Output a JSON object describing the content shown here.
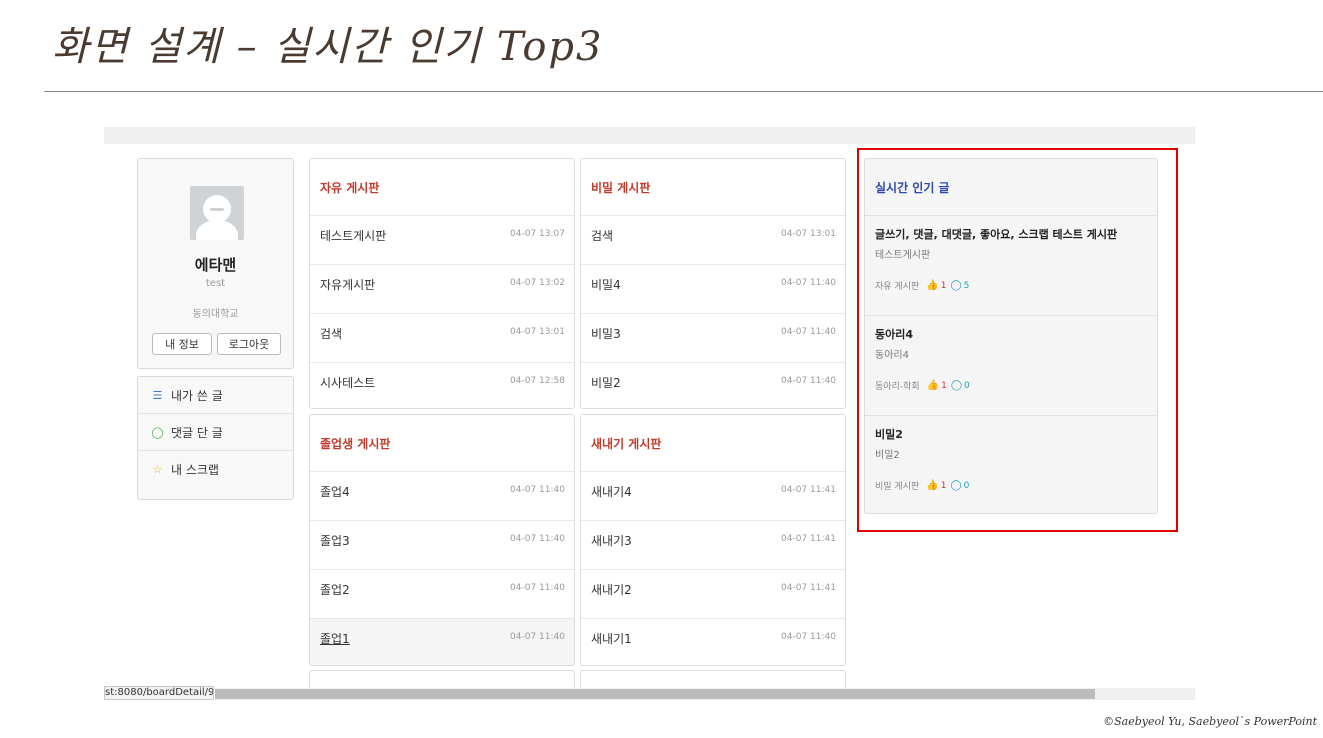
{
  "slide": {
    "title": "화면 설계 – 실시간 인기 Top3",
    "copyright": "©Saebyeol Yu, Saebyeol`s PowerPoint"
  },
  "profile": {
    "name": "에타맨",
    "id": "test",
    "school": "동의대학교",
    "my_info_button": "내 정보",
    "logout_button": "로그아웃"
  },
  "menu": {
    "items": [
      {
        "label": "내가 쓴 글",
        "icon": "list-icon"
      },
      {
        "label": "댓글 단 글",
        "icon": "comment-icon"
      },
      {
        "label": "내 스크랩",
        "icon": "star-icon"
      }
    ]
  },
  "boards": [
    {
      "title": "자유 게시판",
      "posts": [
        {
          "title": "테스트게시판",
          "date": "04-07 13:07"
        },
        {
          "title": "자유게시판",
          "date": "04-07 13:02"
        },
        {
          "title": "검색",
          "date": "04-07 13:01"
        },
        {
          "title": "시사테스트",
          "date": "04-07 12:58"
        }
      ]
    },
    {
      "title": "비밀 게시판",
      "posts": [
        {
          "title": "검색",
          "date": "04-07 13:01"
        },
        {
          "title": "비밀4",
          "date": "04-07 11:40"
        },
        {
          "title": "비밀3",
          "date": "04-07 11:40"
        },
        {
          "title": "비밀2",
          "date": "04-07 11:40"
        }
      ]
    },
    {
      "title": "졸업생 게시판",
      "posts": [
        {
          "title": "졸업4",
          "date": "04-07 11:40"
        },
        {
          "title": "졸업3",
          "date": "04-07 11:40"
        },
        {
          "title": "졸업2",
          "date": "04-07 11:40"
        },
        {
          "title": "졸업1",
          "date": "04-07 11:40"
        }
      ]
    },
    {
      "title": "새내기 게시판",
      "posts": [
        {
          "title": "새내기4",
          "date": "04-07 11:41"
        },
        {
          "title": "새내기3",
          "date": "04-07 11:41"
        },
        {
          "title": "새내기2",
          "date": "04-07 11:41"
        },
        {
          "title": "새내기1",
          "date": "04-07 11:40"
        }
      ]
    }
  ],
  "popular": {
    "title": "실시간 인기 글",
    "items": [
      {
        "title": "글쓰기, 댓글, 대댓글, 좋아요, 스크랩 테스트 게시판",
        "content": "테스트게시판",
        "board": "자유 게시판",
        "likes": "1",
        "comments": "5"
      },
      {
        "title": "동아리4",
        "content": "동아리4",
        "board": "동아리-학회",
        "likes": "1",
        "comments": "0"
      },
      {
        "title": "비밀2",
        "content": "비밀2",
        "board": "비밀 게시판",
        "likes": "1",
        "comments": "0"
      }
    ]
  },
  "status_bar": {
    "url": "st:8080/boardDetail/9"
  },
  "colors": {
    "board_title": "#c33a2c",
    "popular_title": "#2e4aa8",
    "highlight_border": "#e00000",
    "like": "#d32f2f",
    "comment": "#1f9fb3"
  }
}
